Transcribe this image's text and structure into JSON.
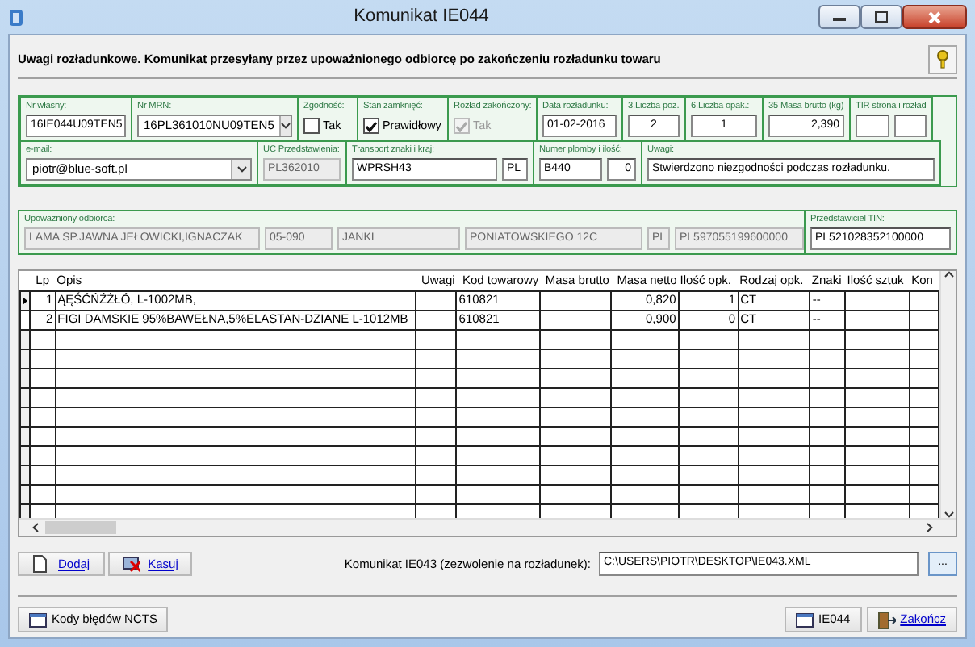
{
  "window": {
    "title": "Komunikat IE044"
  },
  "header_text": "Uwagi rozładunkowe. Komunikat przesyłany przez upoważnionego odbiorcę po zakończeniu rozładunku towaru",
  "form_row_1": [
    {
      "label": "Nr własny:",
      "controls": [
        {
          "kind": "text",
          "value": "16IE044U09TEN5"
        }
      ]
    },
    {
      "label": "Nr MRN:",
      "controls": [
        {
          "kind": "select",
          "value": "16PL361010NU09TEN5"
        }
      ]
    },
    {
      "label": "Zgodność:",
      "controls": [
        {
          "kind": "checkbox",
          "text": "Tak",
          "checked": false,
          "disabled": false
        }
      ]
    },
    {
      "label": "Stan zamknięć:",
      "controls": [
        {
          "kind": "checkbox",
          "text": "Prawidłowy",
          "checked": true,
          "disabled": false
        }
      ]
    },
    {
      "label": "Rozład zakończony:",
      "controls": [
        {
          "kind": "checkbox",
          "text": "Tak",
          "checked": true,
          "disabled": true
        }
      ]
    },
    {
      "label": "Data rozładunku:",
      "controls": [
        {
          "kind": "text",
          "value": "01-02-2016"
        }
      ]
    },
    {
      "label": "3.Liczba poz.",
      "controls": [
        {
          "kind": "number",
          "value": "2"
        }
      ]
    },
    {
      "label": "6.Liczba opak.:",
      "controls": [
        {
          "kind": "number",
          "value": "1"
        }
      ]
    },
    {
      "label": "35 Masa brutto (kg)",
      "controls": [
        {
          "kind": "amount",
          "value": "2,390"
        }
      ]
    },
    {
      "label": "TIR strona i rozład",
      "controls": [
        {
          "kind": "text"
        },
        {
          "kind": "text"
        }
      ]
    }
  ],
  "form_row_2": [
    {
      "label": "e-mail:",
      "controls": [
        {
          "kind": "select",
          "value": "piotr@blue-soft.pl"
        }
      ]
    },
    {
      "label": "UC Przedstawienia:",
      "controls": [
        {
          "kind": "text",
          "value": "PL362010",
          "disabled": true
        }
      ]
    },
    {
      "label": "Transport znaki i kraj:",
      "controls": [
        {
          "kind": "text",
          "value": "WPRSH43"
        },
        {
          "kind": "short",
          "value": "PL"
        }
      ]
    },
    {
      "label": "Numer plomby i ilość:",
      "controls": [
        {
          "kind": "text",
          "value": "B440"
        },
        {
          "kind": "amount",
          "value": "0"
        }
      ]
    },
    {
      "label": "Uwagi:",
      "controls": [
        {
          "kind": "text",
          "value": "Stwierdzono niezgodności podczas rozładunku."
        }
      ]
    }
  ],
  "consignee": {
    "label": "Upoważniony odbiorca:",
    "fields": [
      "LAMA SP.JAWNA JEŁOWICKI,IGNACZAK",
      "05-090",
      "JANKI",
      "PONIATOWSKIEGO 12C",
      "PL",
      "PL597055199600000"
    ]
  },
  "representative": {
    "label": "Przedstawiciel TIN:",
    "value": "PL521028352100000"
  },
  "table": {
    "columns": [
      "Lp",
      "Opis",
      "Uwagi",
      "Kod towarowy",
      "Masa brutto",
      "Masa netto",
      "Ilość opk.",
      "Rodzaj opk.",
      "Znaki",
      "Ilość sztuk",
      "Kon"
    ],
    "rows": [
      {
        "selected": true,
        "cells": [
          "1",
          "ĄĘŚĆŃŹŻŁÓ, L-1002MB,",
          "",
          "610821",
          "",
          "0,820",
          "1",
          "CT",
          "--",
          "",
          ""
        ]
      },
      {
        "selected": false,
        "cells": [
          "2",
          "FIGI DAMSKIE 95%BAWEŁNA,5%ELASTAN-DZIANE L-1012MB",
          "",
          "610821",
          "",
          "0,900",
          "0",
          "CT",
          "--",
          "",
          ""
        ]
      }
    ]
  },
  "actions": [
    "Dodaj",
    "Kasuj"
  ],
  "file_field": {
    "label": "Komunikat IE043 (zezwolenie na rozładunek):",
    "value": "C:\\USERS\\PIOTR\\DESKTOP\\IE043.XML",
    "button": "..."
  },
  "footer_buttons": [
    {
      "kind": "codes",
      "label": "Kody błędów NCTS"
    },
    {
      "kind": "send",
      "label": "IE044"
    },
    {
      "kind": "exit",
      "label": "Zakończ"
    }
  ]
}
